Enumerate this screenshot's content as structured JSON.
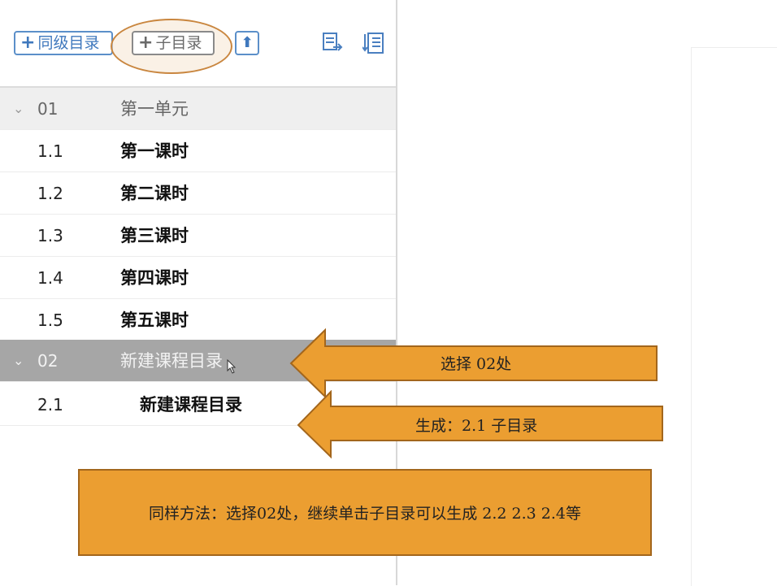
{
  "toolbar": {
    "sibling_label": "同级目录",
    "child_label": "子目录",
    "plus_glyph": "+",
    "up_glyph": "⬆",
    "icons": [
      "move-up-icon",
      "export-icon",
      "sort-list-icon"
    ]
  },
  "tree": {
    "unit1": {
      "num": "01",
      "title": "第一单元",
      "chevron": "⌄"
    },
    "lessons": [
      {
        "num": "1.1",
        "title": "第一课时"
      },
      {
        "num": "1.2",
        "title": "第二课时"
      },
      {
        "num": "1.3",
        "title": "第三课时"
      },
      {
        "num": "1.4",
        "title": "第四课时"
      },
      {
        "num": "1.5",
        "title": "第五课时"
      }
    ],
    "unit2": {
      "num": "02",
      "title": "新建课程目录",
      "chevron": "⌄"
    },
    "sub": {
      "num": "2.1",
      "title": "新建课程目录"
    }
  },
  "annotations": {
    "arrow1": "选择 02处",
    "arrow2": "生成：2.1 子目录",
    "box": "同样方法：选择02处，继续单击子目录可以生成 2.2 2.3 2.4等"
  },
  "colors": {
    "accent_blue": "#3f78bd",
    "annotation_orange": "#eb9e31",
    "selected_row": "#a6a6a6"
  }
}
